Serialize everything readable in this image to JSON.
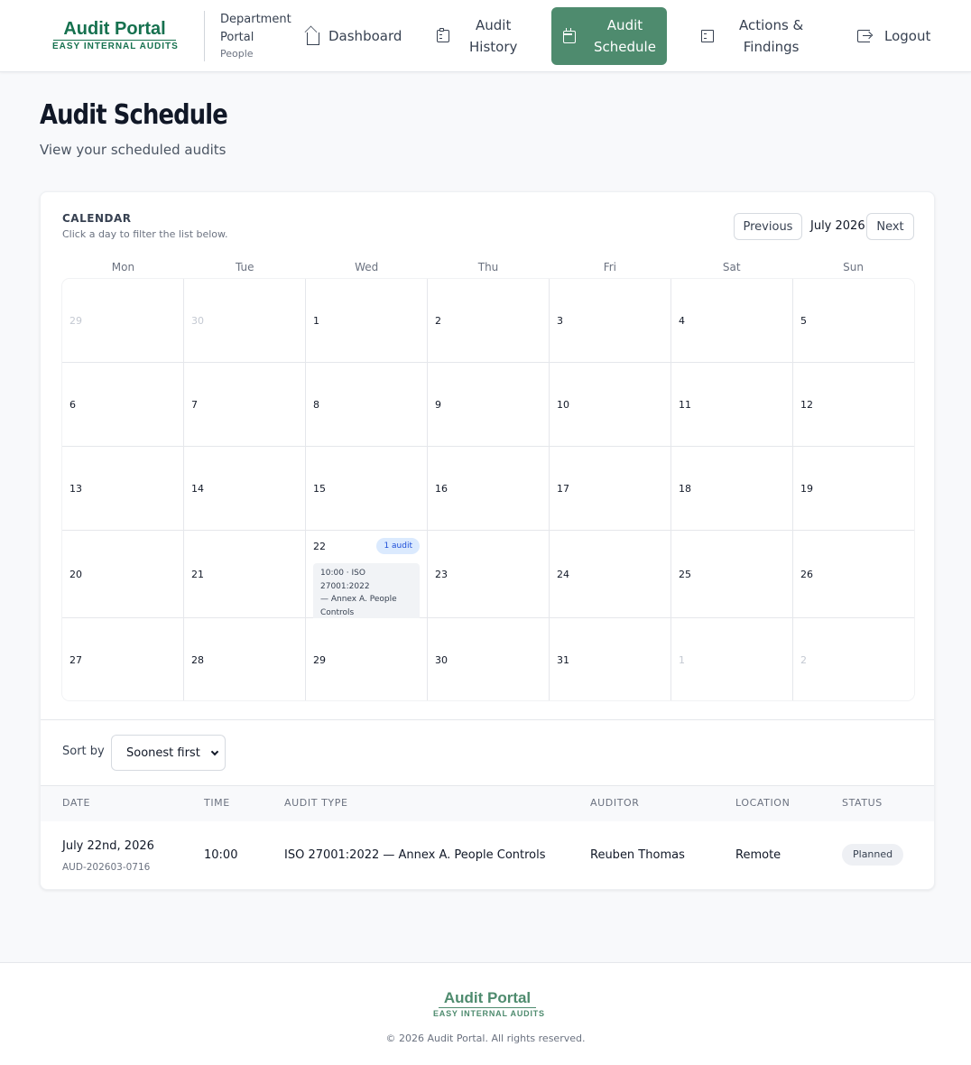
{
  "brand": {
    "title": "Audit Portal",
    "subtitle": "EASY INTERNAL AUDITS"
  },
  "department": {
    "line1": "Department",
    "line2": "Portal",
    "name": "People"
  },
  "nav": {
    "dashboard": {
      "label": "Dashboard",
      "icon": "home-icon"
    },
    "audit_history": {
      "label1": "Audit",
      "label2": "History",
      "icon": "clipboard-icon"
    },
    "audit_schedule": {
      "label1": "Audit",
      "label2": "Schedule",
      "icon": "calendar-icon",
      "active": true
    },
    "actions_findings": {
      "label1": "Actions &",
      "label2": "Findings",
      "icon": "document-icon"
    },
    "logout": {
      "label": "Logout",
      "icon": "logout-icon"
    }
  },
  "page": {
    "title": "Audit Schedule",
    "subtitle": "View your scheduled audits"
  },
  "calendar": {
    "heading": "CALENDAR",
    "hint": "Click a day to filter the list below.",
    "prev_label": "Previous",
    "next_label": "Next",
    "month_label": "July 2026",
    "weekdays": [
      "Mon",
      "Tue",
      "Wed",
      "Thu",
      "Fri",
      "Sat",
      "Sun"
    ],
    "weeks": [
      [
        "29",
        "30",
        "1",
        "2",
        "3",
        "4",
        "5"
      ],
      [
        "6",
        "7",
        "8",
        "9",
        "10",
        "11",
        "12"
      ],
      [
        "13",
        "14",
        "15",
        "16",
        "17",
        "18",
        "19"
      ],
      [
        "20",
        "21",
        "22",
        "23",
        "24",
        "25",
        "26"
      ],
      [
        "27",
        "28",
        "29",
        "30",
        "31",
        "1",
        "2"
      ]
    ],
    "event_day": {
      "count_badge": "1 audit",
      "chip_line1": "10:00 · ISO 27001:2022",
      "chip_line2": "— Annex A. People",
      "chip_line3": "Controls"
    }
  },
  "sort": {
    "label": "Sort by",
    "selected": "Soonest first"
  },
  "table": {
    "headers": {
      "date": "DATE",
      "time": "TIME",
      "audit_type": "AUDIT TYPE",
      "auditor": "AUDITOR",
      "location": "LOCATION",
      "status": "STATUS"
    },
    "rows": [
      {
        "date": "July 22nd, 2026",
        "audit_id": "AUD-202603-0716",
        "time": "10:00",
        "audit_type": "ISO 27001:2022 — Annex A. People Controls",
        "auditor": "Reuben Thomas",
        "location": "Remote",
        "status": "Planned"
      }
    ]
  },
  "footer": {
    "title": "Audit Portal",
    "subtitle": "EASY INTERNAL AUDITS",
    "copyright": "© 2026 Audit Portal. All rights reserved."
  },
  "colors": {
    "brand": "#16714f",
    "nav_active": "#4e8b6e",
    "badge_bg": "#dbeafe",
    "badge_text": "#1d4ed8"
  }
}
